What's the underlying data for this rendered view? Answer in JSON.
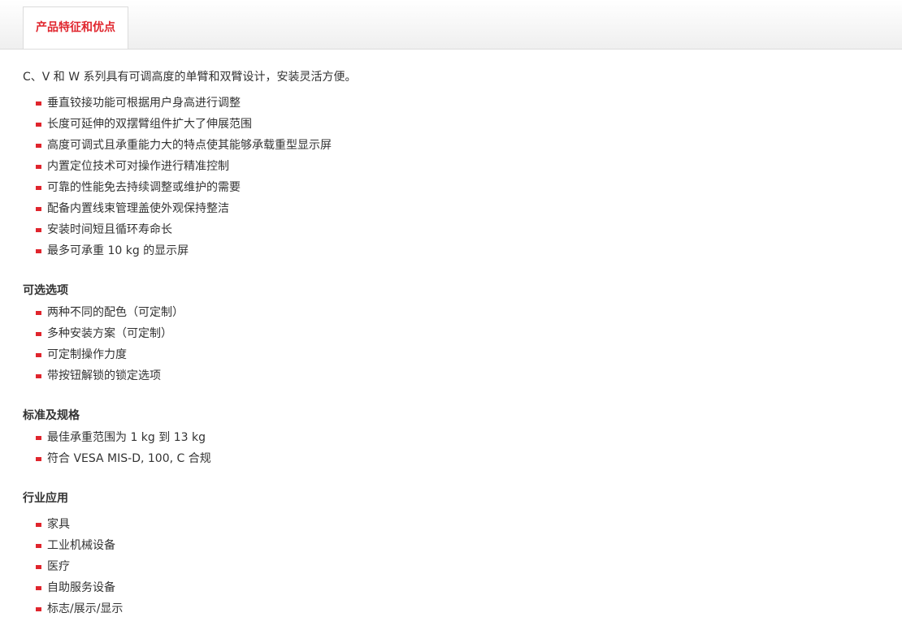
{
  "tab": {
    "label": "产品特征和优点"
  },
  "intro": "C、V 和 W 系列具有可调高度的单臂和双臂设计，安装灵活方便。",
  "features": [
    "垂直铰接功能可根据用户身高进行调整",
    "长度可延伸的双摆臂组件扩大了伸展范围",
    "高度可调式且承重能力大的特点使其能够承载重型显示屏",
    "内置定位技术可对操作进行精准控制",
    "可靠的性能免去持续调整或维护的需要",
    "配备内置线束管理盖使外观保持整洁",
    "安装时间短且循环寿命长",
    "最多可承重 10 kg 的显示屏"
  ],
  "options": {
    "title": "可选选项",
    "items": [
      "两种不同的配色（可定制）",
      "多种安装方案（可定制）",
      "可定制操作力度",
      "带按钮解锁的锁定选项"
    ]
  },
  "standards": {
    "title": "标准及规格",
    "items": [
      "最佳承重范围为 1 kg 到 13 kg",
      "符合 VESA MIS-D, 100, C 合规"
    ]
  },
  "applications": {
    "title": "行业应用",
    "items": [
      "家具",
      "工业机械设备",
      "医疗",
      "自助服务设备",
      "标志/展示/显示"
    ]
  },
  "colors": {
    "accent": "#e0252d",
    "text": "#333333",
    "border": "#dcdcdc"
  }
}
